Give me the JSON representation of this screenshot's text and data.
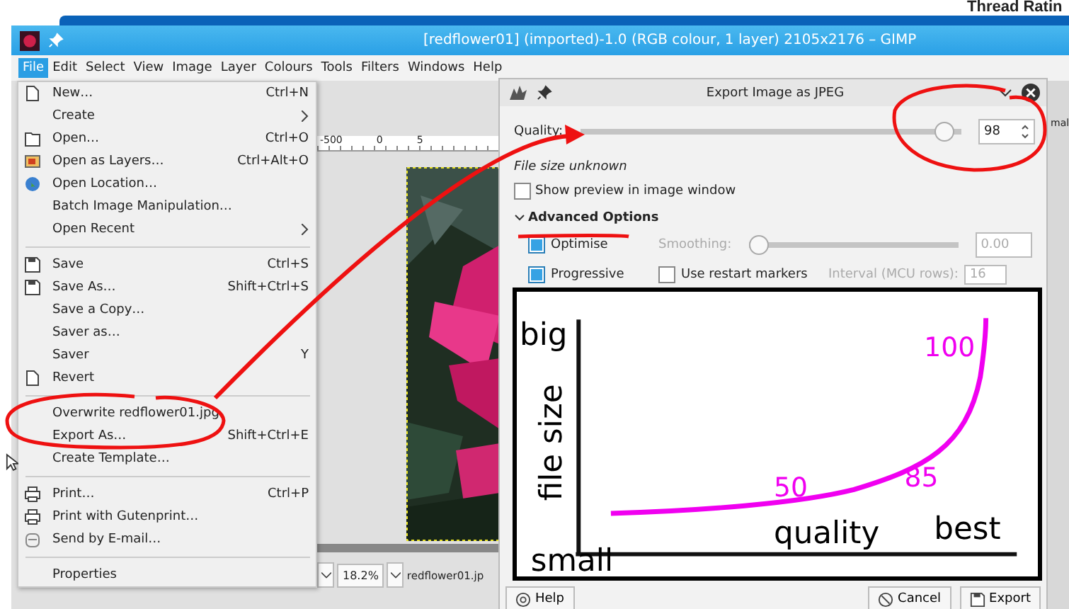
{
  "browser": {
    "heading": "Thread Ratin"
  },
  "window": {
    "title": "[redflower01] (imported)-1.0 (RGB colour, 1 layer) 2105x2176 – GIMP"
  },
  "menubar": [
    {
      "label": "File",
      "selected": true
    },
    {
      "label": "Edit",
      "selected": false
    },
    {
      "label": "Select",
      "selected": false
    },
    {
      "label": "View",
      "selected": false
    },
    {
      "label": "Image",
      "selected": false
    },
    {
      "label": "Layer",
      "selected": false
    },
    {
      "label": "Colours",
      "selected": false
    },
    {
      "label": "Tools",
      "selected": false
    },
    {
      "label": "Filters",
      "selected": false
    },
    {
      "label": "Windows",
      "selected": false
    },
    {
      "label": "Help",
      "selected": false
    }
  ],
  "ruler": [
    "-500",
    "0",
    "5"
  ],
  "file_menu": [
    {
      "kind": "item",
      "label": "New…",
      "shortcut": "Ctrl+N"
    },
    {
      "kind": "submenu",
      "label": "Create"
    },
    {
      "kind": "item",
      "label": "Open…",
      "shortcut": "Ctrl+O"
    },
    {
      "kind": "item",
      "label": "Open as Layers…",
      "shortcut": "Ctrl+Alt+O"
    },
    {
      "kind": "item",
      "label": "Open Location…"
    },
    {
      "kind": "item",
      "label": "Batch Image Manipulation…"
    },
    {
      "kind": "submenu",
      "label": "Open Recent"
    },
    {
      "kind": "separator"
    },
    {
      "kind": "item",
      "label": "Save",
      "shortcut": "Ctrl+S"
    },
    {
      "kind": "item",
      "label": "Save As…",
      "shortcut": "Shift+Ctrl+S"
    },
    {
      "kind": "item",
      "label": "Save a Copy…"
    },
    {
      "kind": "item",
      "label": "Saver as…"
    },
    {
      "kind": "item",
      "label": "Saver",
      "shortcut": "Y"
    },
    {
      "kind": "item",
      "label": "Revert"
    },
    {
      "kind": "separator"
    },
    {
      "kind": "item",
      "label": "Overwrite redflower01.jpg"
    },
    {
      "kind": "item",
      "label": "Export As…",
      "shortcut": "Shift+Ctrl+E"
    },
    {
      "kind": "item",
      "label": "Create Template…"
    },
    {
      "kind": "separator"
    },
    {
      "kind": "item",
      "label": "Print…",
      "shortcut": "Ctrl+P"
    },
    {
      "kind": "item",
      "label": "Print with Gutenprint…"
    },
    {
      "kind": "item",
      "label": "Send by E-mail…"
    },
    {
      "kind": "separator"
    },
    {
      "kind": "item",
      "label": "Properties"
    }
  ],
  "status_bar": {
    "zoom": "18.2%",
    "file": "redflower01.jp"
  },
  "dock": {
    "mode": "mal"
  },
  "export_dialog": {
    "title": "Export Image as JPEG",
    "quality": {
      "label": "Quality:",
      "level": 0.98,
      "value": "98"
    },
    "file_size": "File size unknown",
    "show_preview": {
      "label": "Show preview in image window",
      "checked": false
    },
    "advanced": {
      "label": "Advanced Options",
      "expanded": true
    },
    "optimise": {
      "label": "Optimise",
      "checked": true
    },
    "smoothing": {
      "label": "Smoothing:",
      "level": 0,
      "value": "0.00",
      "disabled": true
    },
    "progressive": {
      "label": "Progressive",
      "checked": true
    },
    "restart_markers": {
      "label": "Use restart markers",
      "checked": false
    },
    "interval": {
      "label": "Interval (MCU rows):",
      "value": "16",
      "disabled": true
    },
    "buttons": [
      {
        "kind": "help",
        "label": "Help"
      },
      {
        "kind": "cancel",
        "label": "Cancel"
      },
      {
        "kind": "export",
        "label": "Export"
      }
    ]
  },
  "inset_diagram": {
    "y_top": "big",
    "y_bottom": "small",
    "y_label": "file size",
    "x_label": "quality",
    "x_right": "best",
    "point_labels": [
      "50",
      "85",
      "100"
    ]
  }
}
